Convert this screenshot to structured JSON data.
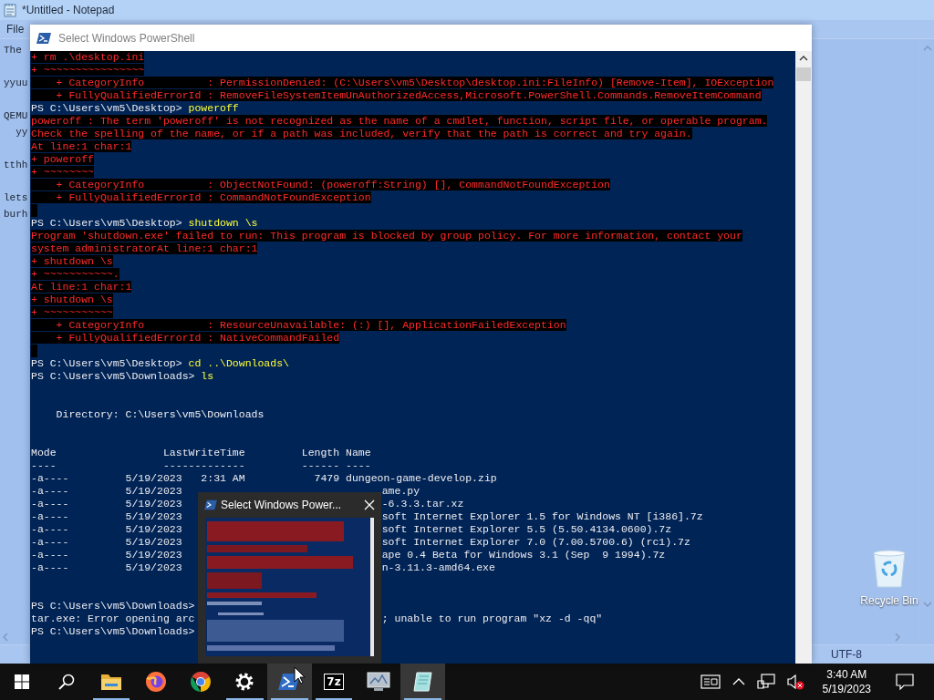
{
  "notepad": {
    "title": "*Untitled - Notepad",
    "menu": [
      "File"
    ],
    "lines": [
      {
        "kind": "text",
        "text": "The"
      },
      {
        "kind": "blank"
      },
      {
        "kind": "text",
        "text": "yyuu"
      },
      {
        "kind": "blank"
      },
      {
        "kind": "text",
        "text": "QEMU"
      },
      {
        "kind": "text",
        "text": "  yy"
      },
      {
        "kind": "blank"
      },
      {
        "kind": "text",
        "text": "tthh"
      },
      {
        "kind": "blank"
      },
      {
        "kind": "text",
        "text": "lets"
      },
      {
        "kind": "text",
        "text": "burh"
      }
    ],
    "status": "UTF-8"
  },
  "desktop": {
    "recycle_bin": {
      "label": "Recycle Bin"
    }
  },
  "powershell": {
    "title": "Select Windows PowerShell",
    "lines": [
      {
        "kind": "error",
        "text": "+ rm .\\desktop.ini"
      },
      {
        "kind": "error",
        "text": "+ ~~~~~~~~~~~~~~~~"
      },
      {
        "kind": "error",
        "text": "    + CategoryInfo          : PermissionDenied: (C:\\Users\\vm5\\Desktop\\desktop.ini:FileInfo) [Remove-Item], IOException"
      },
      {
        "kind": "error",
        "text": "    + FullyQualifiedErrorId : RemoveFileSystemItemUnAuthorizedAccess,Microsoft.PowerShell.Commands.RemoveItemCommand"
      },
      {
        "kind": "prompt",
        "prompt": "PS C:\\Users\\vm5\\Desktop>",
        "command": "poweroff"
      },
      {
        "kind": "error",
        "text": "poweroff : The term 'poweroff' is not recognized as the name of a cmdlet, function, script file, or operable program."
      },
      {
        "kind": "error",
        "text": "Check the spelling of the name, or if a path was included, verify that the path is correct and try again."
      },
      {
        "kind": "error",
        "text": "At line:1 char:1"
      },
      {
        "kind": "error",
        "text": "+ poweroff"
      },
      {
        "kind": "error",
        "text": "+ ~~~~~~~~"
      },
      {
        "kind": "error",
        "text": "    + CategoryInfo          : ObjectNotFound: (poweroff:String) [], CommandNotFoundException"
      },
      {
        "kind": "error",
        "text": "    + FullyQualifiedErrorId : CommandNotFoundException"
      },
      {
        "kind": "error-gap"
      },
      {
        "kind": "prompt",
        "prompt": "PS C:\\Users\\vm5\\Desktop>",
        "command": "shutdown \\s"
      },
      {
        "kind": "error",
        "text": "Program 'shutdown.exe' failed to run: This program is blocked by group policy. For more information, contact your"
      },
      {
        "kind": "error",
        "text": "system administratorAt line:1 char:1"
      },
      {
        "kind": "error",
        "text": "+ shutdown \\s"
      },
      {
        "kind": "error",
        "text": "+ ~~~~~~~~~~~."
      },
      {
        "kind": "error",
        "text": "At line:1 char:1"
      },
      {
        "kind": "error",
        "text": "+ shutdown \\s"
      },
      {
        "kind": "error",
        "text": "+ ~~~~~~~~~~~"
      },
      {
        "kind": "error",
        "text": "    + CategoryInfo          : ResourceUnavailable: (:) [], ApplicationFailedException"
      },
      {
        "kind": "error",
        "text": "    + FullyQualifiedErrorId : NativeCommandFailed"
      },
      {
        "kind": "error-gap"
      },
      {
        "kind": "prompt",
        "prompt": "PS C:\\Users\\vm5\\Desktop>",
        "command": "cd ..\\Downloads\\"
      },
      {
        "kind": "prompt",
        "prompt": "PS C:\\Users\\vm5\\Downloads>",
        "command": "ls"
      },
      {
        "kind": "blank"
      },
      {
        "kind": "blank"
      },
      {
        "kind": "output",
        "text": "    Directory: C:\\Users\\vm5\\Downloads"
      },
      {
        "kind": "blank"
      },
      {
        "kind": "blank"
      },
      {
        "kind": "output",
        "text": "Mode                 LastWriteTime         Length Name"
      },
      {
        "kind": "output",
        "text": "----                 -------------         ------ ----"
      },
      {
        "kind": "output",
        "text": "-a----         5/19/2023   2:31 AM           7479 dungeon-game-develop.zip"
      },
      {
        "kind": "output",
        "text": "-a----         5/19/2023",
        "right": "ame.py"
      },
      {
        "kind": "output",
        "text": "-a----         5/19/2023",
        "right": "-6.3.3.tar.xz"
      },
      {
        "kind": "output",
        "text": "-a----         5/19/2023",
        "right": "soft Internet Explorer 1.5 for Windows NT [i386].7z"
      },
      {
        "kind": "output",
        "text": "-a----         5/19/2023",
        "right": "soft Internet Explorer 5.5 (5.50.4134.0600).7z"
      },
      {
        "kind": "output",
        "text": "-a----         5/19/2023",
        "right": "soft Internet Explorer 7.0 (7.00.5700.6) (rc1).7z"
      },
      {
        "kind": "output",
        "text": "-a----         5/19/2023",
        "right": "ape 0.4 Beta for Windows 3.1 (Sep  9 1994).7z"
      },
      {
        "kind": "output",
        "text": "-a----         5/19/2023",
        "right": "n-3.11.3-amd64.exe"
      },
      {
        "kind": "blank"
      },
      {
        "kind": "blank"
      },
      {
        "kind": "prompt",
        "prompt": "PS C:\\Users\\vm5\\Downloads>"
      },
      {
        "kind": "output",
        "text": "tar.exe: Error opening arc",
        "right": "; unable to run program \"xz -d -qq\""
      },
      {
        "kind": "prompt",
        "prompt": "PS C:\\Users\\vm5\\Downloads>"
      }
    ]
  },
  "thumbnail": {
    "title": "Select Windows Power..."
  },
  "taskbar": {
    "apps": [
      {
        "kind": "start",
        "running": false,
        "highlighted": false
      },
      {
        "kind": "search",
        "running": false,
        "highlighted": false
      },
      {
        "kind": "explorer",
        "running": true,
        "highlighted": false
      },
      {
        "kind": "firefox",
        "running": false,
        "highlighted": false
      },
      {
        "kind": "chrome",
        "running": false,
        "highlighted": false
      },
      {
        "kind": "settings",
        "running": true,
        "highlighted": false
      },
      {
        "kind": "powershell",
        "running": true,
        "highlighted": true
      },
      {
        "kind": "archiver",
        "label": "7z",
        "running": true,
        "highlighted": false
      },
      {
        "kind": "monitor",
        "running": false,
        "highlighted": false
      },
      {
        "kind": "notepad",
        "running": true,
        "highlighted": true
      }
    ],
    "tray": {
      "time": "3:40 AM",
      "date": "5/19/2023"
    }
  }
}
